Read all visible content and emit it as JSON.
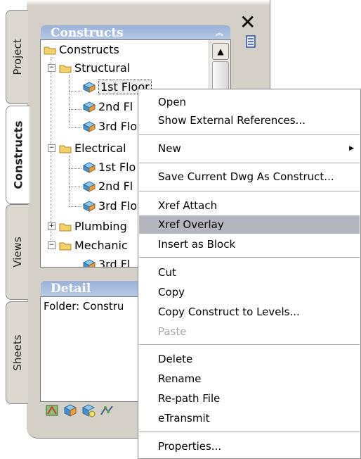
{
  "tabs": [
    {
      "label": "Project",
      "active": false
    },
    {
      "label": "Constructs",
      "active": true
    },
    {
      "label": "Views",
      "active": false
    },
    {
      "label": "Sheets",
      "active": false
    }
  ],
  "constructs_panel": {
    "title": "Constructs",
    "tree": [
      {
        "label": "Constructs",
        "icon": "folder-icon",
        "expander": "",
        "level": 0
      },
      {
        "label": "Structural",
        "icon": "folder-icon",
        "expander": "−",
        "level": 1
      },
      {
        "label": "1st Floor",
        "icon": "cube-icon",
        "expander": "",
        "level": 2,
        "selected": true
      },
      {
        "label": "2nd Fl",
        "icon": "cube-icon",
        "expander": "",
        "level": 2
      },
      {
        "label": "3rd Flo",
        "icon": "cube-icon",
        "expander": "",
        "level": 2
      },
      {
        "label": "Electrical",
        "icon": "folder-icon",
        "expander": "−",
        "level": 1
      },
      {
        "label": "1st Flo",
        "icon": "cube-icon",
        "expander": "",
        "level": 2
      },
      {
        "label": "2nd Fl",
        "icon": "cube-icon",
        "expander": "",
        "level": 2
      },
      {
        "label": "3rd Flo",
        "icon": "cube-icon",
        "expander": "",
        "level": 2
      },
      {
        "label": "Plumbing",
        "icon": "folder-icon",
        "expander": "+",
        "level": 1
      },
      {
        "label": "Mechanic",
        "icon": "folder-icon",
        "expander": "−",
        "level": 1
      },
      {
        "label": "3rd Fl",
        "icon": "cube-icon",
        "expander": "",
        "level": 2
      }
    ]
  },
  "detail_panel": {
    "title": "Detail",
    "text": "Folder: Constru"
  },
  "toolbar": {
    "buttons": [
      "add-construct-icon",
      "add-element-icon",
      "xref-icon",
      "regenerate-icon"
    ]
  },
  "window_controls": {
    "close": "✕"
  },
  "context_menu": {
    "items": [
      {
        "label": "Open",
        "type": "item"
      },
      {
        "label": "Show External References...",
        "type": "item"
      },
      {
        "type": "separator"
      },
      {
        "label": "New",
        "type": "submenu"
      },
      {
        "type": "separator"
      },
      {
        "label": "Save Current Dwg As Construct...",
        "type": "item"
      },
      {
        "type": "separator"
      },
      {
        "label": "Xref Attach",
        "type": "item"
      },
      {
        "label": "Xref Overlay",
        "type": "item",
        "highlight": true
      },
      {
        "label": "Insert as Block",
        "type": "item"
      },
      {
        "type": "separator"
      },
      {
        "label": "Cut",
        "type": "item"
      },
      {
        "label": "Copy",
        "type": "item"
      },
      {
        "label": "Copy Construct to Levels...",
        "type": "item"
      },
      {
        "label": "Paste",
        "type": "item",
        "disabled": true
      },
      {
        "type": "separator"
      },
      {
        "label": "Delete",
        "type": "item"
      },
      {
        "label": "Rename",
        "type": "item"
      },
      {
        "label": "Re-path File",
        "type": "item"
      },
      {
        "label": "eTransmit",
        "type": "item"
      },
      {
        "type": "separator"
      },
      {
        "label": "Properties...",
        "type": "item"
      }
    ]
  },
  "colors": {
    "panel_bg": "#d4d0c8",
    "section_title": "#a6bce0",
    "menu_highlight": "#b5b5bf",
    "disabled_text": "#a8a8a8"
  }
}
